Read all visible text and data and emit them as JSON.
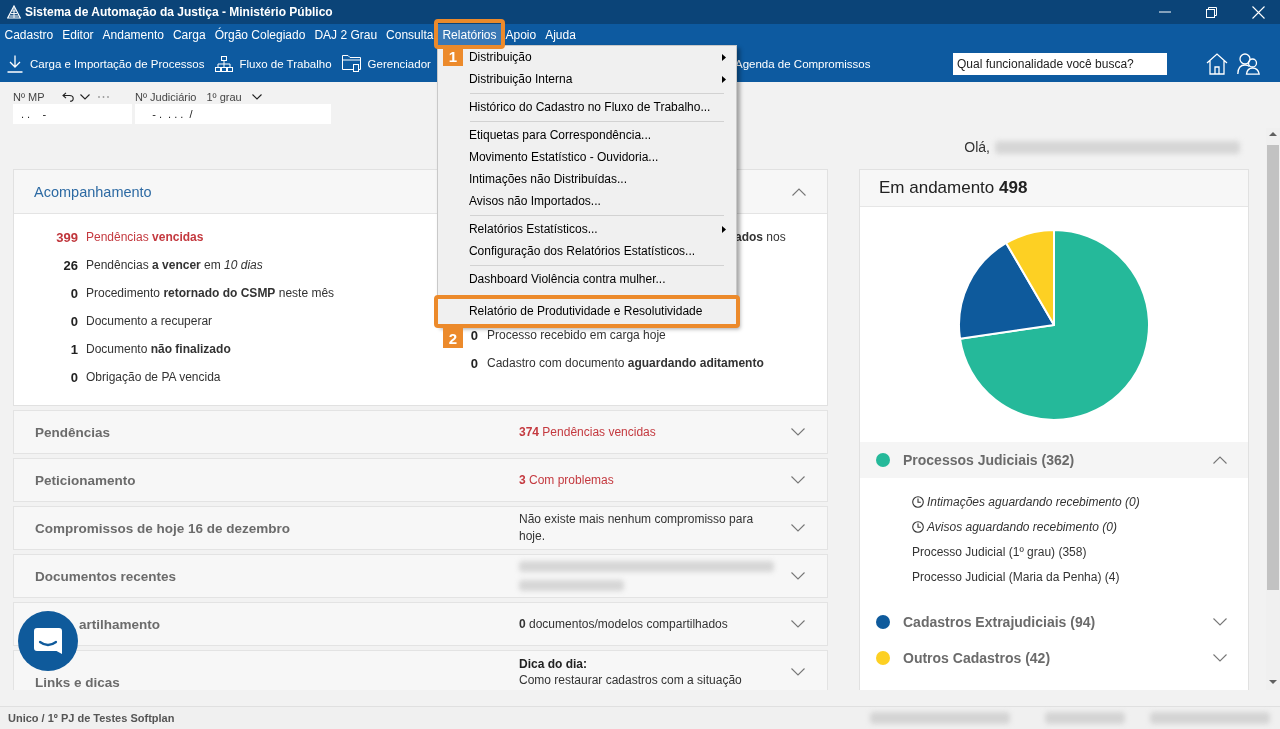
{
  "window": {
    "title": "Sistema de Automação da Justiça - Ministério Público"
  },
  "menu_bar": [
    {
      "label": "Cadastro",
      "selected": false
    },
    {
      "label": "Editor",
      "selected": false
    },
    {
      "label": "Andamento",
      "selected": false
    },
    {
      "label": "Carga",
      "selected": false
    },
    {
      "label": "Órgão Colegiado",
      "selected": false
    },
    {
      "label": "DAJ 2 Grau",
      "selected": false
    },
    {
      "label": "Consulta",
      "selected": false
    },
    {
      "label": "Relatórios",
      "selected": true,
      "callout": "1"
    },
    {
      "label": "Apoio",
      "selected": false
    },
    {
      "label": "Ajuda",
      "selected": false
    }
  ],
  "dropdown": {
    "items": [
      {
        "kind": "option",
        "label": "Distribuição",
        "submenu": true
      },
      {
        "kind": "option",
        "label": "Distribuição Interna",
        "submenu": true
      },
      {
        "kind": "separator"
      },
      {
        "kind": "option",
        "label": "Histórico do Cadastro no Fluxo de Trabalho...",
        "submenu": false
      },
      {
        "kind": "separator"
      },
      {
        "kind": "option",
        "label": "Etiquetas para Correspondência...",
        "submenu": false
      },
      {
        "kind": "option",
        "label": "Movimento Estatístico - Ouvidoria...",
        "submenu": false
      },
      {
        "kind": "option",
        "label": "Intimações não Distribuídas...",
        "submenu": false
      },
      {
        "kind": "option",
        "label": "Avisos não Importados...",
        "submenu": false
      },
      {
        "kind": "separator"
      },
      {
        "kind": "option",
        "label": "Relatórios Estatísticos...",
        "submenu": true
      },
      {
        "kind": "option",
        "label": "Configuração dos Relatórios Estatísticos...",
        "submenu": false
      },
      {
        "kind": "separator"
      },
      {
        "kind": "option",
        "label": "Dashboard Violência contra mulher...",
        "submenu": false
      },
      {
        "kind": "option",
        "label": "Relatório de Produtividade e Resolutividade",
        "submenu": false,
        "callout": "2"
      }
    ]
  },
  "toolbar": {
    "items": [
      {
        "kind": "download",
        "label": "Carga e Importação de Processos"
      },
      {
        "kind": "workflow",
        "label": "Fluxo de Trabalho"
      },
      {
        "kind": "folder",
        "label": "Gerenciador"
      },
      {
        "kind": "plain",
        "label": "Agenda de Compromissos"
      }
    ],
    "search": {
      "placeholder": "Qual funcionalidade você busca?"
    }
  },
  "lookup": {
    "mp": {
      "label": "Nº MP",
      "value": ". .    -"
    },
    "judicial": {
      "label": "Nº Judiciário",
      "instance": "1º grau",
      "value": "   - .  . . .  /"
    }
  },
  "greeting": "Olá,",
  "tracking": {
    "title": "Acompanhamento",
    "expanded": true,
    "left": [
      {
        "count": "399",
        "text": "Pendências **vencidas**",
        "alert": true
      },
      {
        "count": "26",
        "text": "Pendências **a vencer** em *10 dias*",
        "alert": false
      },
      {
        "count": "0",
        "text": "Procedimento **retornado do CSMP** neste mês",
        "alert": false
      },
      {
        "count": "0",
        "text": "Documento a recuperar",
        "alert": false
      },
      {
        "count": "1",
        "text": "Documento **não finalizado**",
        "alert": false
      },
      {
        "count": "0",
        "text": "Obrigação de PA vencida",
        "alert": false
      }
    ],
    "right_fragment": "**ados** nos",
    "right": [
      {
        "count": "0",
        "text": "Processo recebido em carga hoje",
        "alert": false
      },
      {
        "count": "0",
        "text": "Cadastro com documento **aguardando aditamento**",
        "alert": false
      }
    ]
  },
  "sections": [
    {
      "kind": "text",
      "title": "Pendências",
      "summary": "**374** Pendências vencidas",
      "alert": true,
      "expanded": false,
      "partly_hidden": false
    },
    {
      "kind": "text",
      "title": "Peticionamento",
      "summary": "**3** Com problemas",
      "alert": true,
      "expanded": false,
      "partly_hidden": false
    },
    {
      "kind": "text",
      "title": "Compromissos de hoje 16 de dezembro",
      "summary": "Não existe mais nenhum compromisso para hoje.",
      "alert": false,
      "expanded": false,
      "partly_hidden": false
    },
    {
      "kind": "blurred",
      "title": "Documentos recentes",
      "expanded": false,
      "partly_hidden": false
    },
    {
      "kind": "text",
      "title": "artilhamento",
      "summary": "**0** documentos/modelos compartilhados",
      "alert": false,
      "expanded": false,
      "partly_hidden": true
    },
    {
      "kind": "tip",
      "title": "Links e dicas",
      "tip_title": "Dica do dia:",
      "summary": "Como restaurar cadastros com a situação",
      "alert": false,
      "expanded": false,
      "partly_hidden": false
    }
  ],
  "in_progress": {
    "title": "Em andamento **498**",
    "chart_data": {
      "type": "pie",
      "categories": [
        "Processos Judiciais",
        "Cadastros Extrajudiciais",
        "Outros Cadastros"
      ],
      "values": [
        72.7,
        18.9,
        8.4
      ]
    },
    "legend": [
      {
        "count": "(**362**)",
        "color": "#25b99a",
        "expanded": true,
        "children": [
          {
            "kind": "pending",
            "text": "Intimações aguardando recebimento (0)"
          },
          {
            "kind": "pending",
            "text": "Avisos aguardando recebimento (0)"
          },
          {
            "kind": "count",
            "text": "Processo Judicial (1º grau) (358)"
          },
          {
            "kind": "count",
            "text": "Processo Judicial (Maria da Penha) (4)"
          }
        ]
      },
      {
        "count": "(**94**)",
        "color": "#0e5a9c",
        "expanded": false
      },
      {
        "count": "(**42**)",
        "color": "#fdd023",
        "expanded": false
      }
    ]
  },
  "status_bar": {
    "text": "Unico / 1º PJ de Testes Softplan"
  }
}
